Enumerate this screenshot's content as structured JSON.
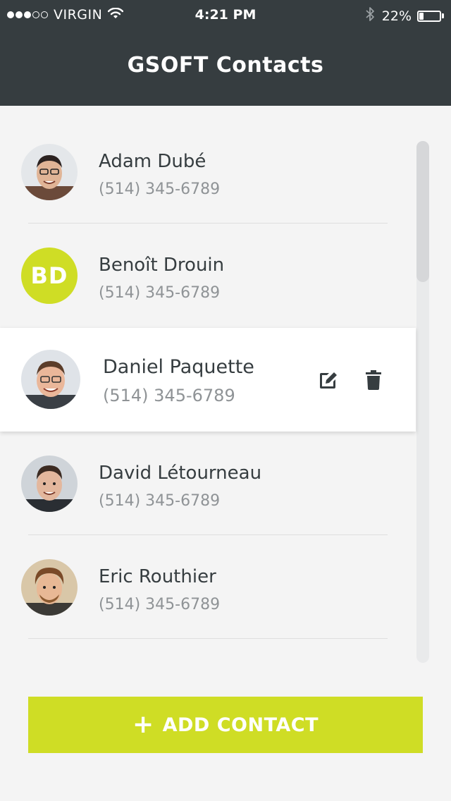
{
  "status_bar": {
    "carrier": "VIRGIN",
    "time": "4:21 PM",
    "battery": "22%",
    "battery_level": 0.22,
    "signal_bars_filled": 3,
    "signal_bars_total": 5
  },
  "header": {
    "title": "GSOFT Contacts"
  },
  "contacts": [
    {
      "name": "Adam Dubé",
      "phone": "(514) 345-6789",
      "avatar": "photo",
      "selected": false
    },
    {
      "name": "Benoît Drouin",
      "phone": "(514) 345-6789",
      "avatar": "initials",
      "initials": "BD",
      "selected": false
    },
    {
      "name": "Daniel Paquette",
      "phone": "(514) 345-6789",
      "avatar": "photo",
      "selected": true
    },
    {
      "name": "David Létourneau",
      "phone": "(514) 345-6789",
      "avatar": "photo",
      "selected": false
    },
    {
      "name": "Eric Routhier",
      "phone": "(514) 345-6789",
      "avatar": "photo",
      "selected": false
    }
  ],
  "row_actions": {
    "edit_icon": "pencil-square-icon",
    "delete_icon": "trash-icon"
  },
  "add_button": {
    "label": "ADD CONTACT",
    "icon": "plus-icon"
  },
  "colors": {
    "header_bg": "#363d40",
    "accent": "#cfdd25",
    "background": "#f4f4f4",
    "name_text": "#363d40",
    "phone_text": "#8f9396"
  }
}
